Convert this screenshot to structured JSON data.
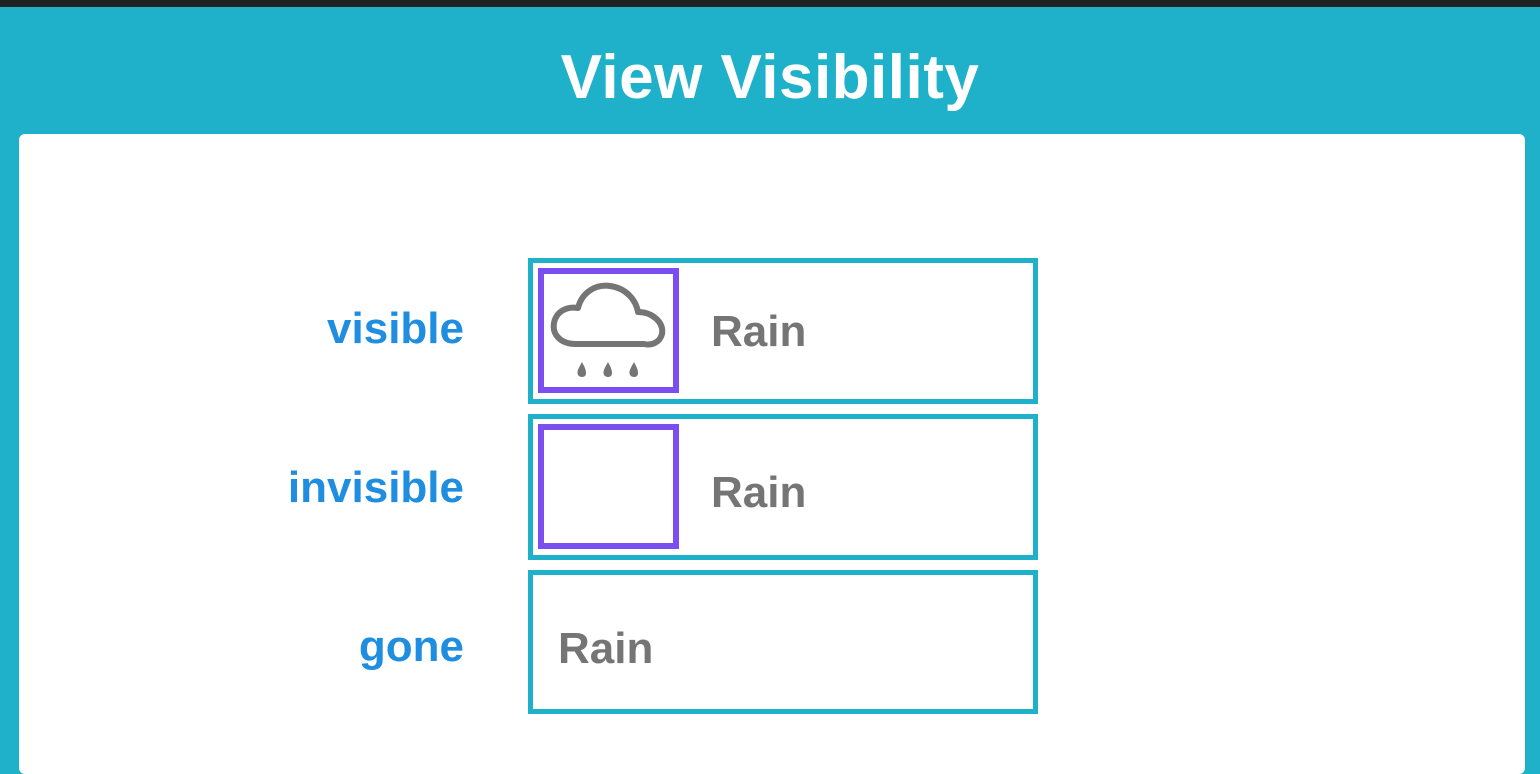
{
  "title": "View Visibility",
  "colors": {
    "background": "#1fb1c9",
    "label": "#1f8ee0",
    "box_border": "#1fb1c9",
    "icon_border": "#7a4ef0",
    "text": "#757575"
  },
  "rows": [
    {
      "label": "visible",
      "text": "Rain",
      "icon": "rain-cloud-icon",
      "icon_state": "visible"
    },
    {
      "label": "invisible",
      "text": "Rain",
      "icon": "rain-cloud-icon",
      "icon_state": "invisible"
    },
    {
      "label": "gone",
      "text": "Rain",
      "icon": "rain-cloud-icon",
      "icon_state": "gone"
    }
  ]
}
